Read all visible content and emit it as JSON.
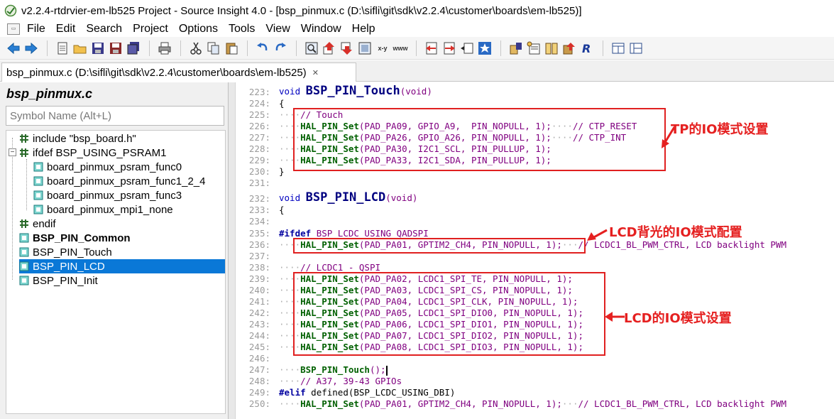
{
  "window": {
    "title": "v2.2.4-rtdrvier-em-lb525 Project - Source Insight 4.0 - [bsp_pinmux.c (D:\\sifli\\git\\sdk\\v2.2.4\\customer\\boards\\em-lb525)]"
  },
  "menu": [
    "File",
    "Edit",
    "Search",
    "Project",
    "Options",
    "Tools",
    "View",
    "Window",
    "Help"
  ],
  "toolbar": {
    "icons": [
      "back-icon",
      "forward-icon",
      "new-file-icon",
      "open-folder-icon",
      "save-icon",
      "save-as-icon",
      "save-all-icon",
      "print-icon",
      "cut-icon",
      "copy-icon",
      "paste-icon",
      "undo-icon",
      "redo-icon",
      "search-icon",
      "jump-up-icon",
      "jump-down-icon",
      "browse-icon",
      "replace-text-icon",
      "web-icon",
      "bookmark-prev-icon",
      "bookmark-next-icon",
      "symbol-window-icon",
      "star-icon",
      "relation-icon",
      "context-icon",
      "book-icon",
      "reference-icon",
      "r-icon",
      "layout-icon",
      "panel-icon"
    ],
    "replace_label": "x-y",
    "web_label": "www"
  },
  "tab": {
    "label": "bsp_pinmux.c (D:\\sifli\\git\\sdk\\v2.2.4\\customer\\boards\\em-lb525)",
    "close": "✕"
  },
  "symbol_panel": {
    "title": "bsp_pinmux.c",
    "search_placeholder": "Symbol Name (Alt+L)",
    "items": [
      {
        "label": "include \"bsp_board.h\"",
        "icon": "include-icon",
        "bold": false,
        "selected": false
      },
      {
        "label": "ifdef BSP_USING_PSRAM1",
        "icon": "ifdef-icon",
        "bold": false,
        "selected": false
      },
      {
        "label": "board_pinmux_psram_func0",
        "icon": "function-icon",
        "bold": false,
        "selected": false
      },
      {
        "label": "board_pinmux_psram_func1_2_4",
        "icon": "function-icon",
        "bold": false,
        "selected": false
      },
      {
        "label": "board_pinmux_psram_func3",
        "icon": "function-icon",
        "bold": false,
        "selected": false
      },
      {
        "label": "board_pinmux_mpi1_none",
        "icon": "function-icon",
        "bold": false,
        "selected": false
      },
      {
        "label": "endif",
        "icon": "endif-icon",
        "bold": false,
        "selected": false
      },
      {
        "label": "BSP_PIN_Common",
        "icon": "function-icon",
        "bold": true,
        "selected": false
      },
      {
        "label": "BSP_PIN_Touch",
        "icon": "function-icon",
        "bold": false,
        "selected": false
      },
      {
        "label": "BSP_PIN_LCD",
        "icon": "function-icon",
        "bold": false,
        "selected": true
      },
      {
        "label": "BSP_PIN_Init",
        "icon": "function-icon",
        "bold": false,
        "selected": false
      }
    ]
  },
  "code": {
    "line_numbers": [
      "223:",
      "224:",
      "225:",
      "226:",
      "227:",
      "228:",
      "229:",
      "230:",
      "231:",
      "232:",
      "233:",
      "234:",
      "235:",
      "236:",
      "237:",
      "238:",
      "239:",
      "240:",
      "241:",
      "242:",
      "243:",
      "244:",
      "245:",
      "246:",
      "247:",
      "248:",
      "249:",
      "250:"
    ],
    "l223_kw": "void",
    "l223_fn": "BSP_PIN_Touch",
    "l223_rest": "(void)",
    "l224": "{",
    "l225_cm": "// Touch",
    "l226_call": "HAL_PIN_Set",
    "l226_args": "(PAD_PA09, GPIO_A9,  PIN_NOPULL, 1);",
    "l226_cm": "// CTP_RESET",
    "l227_call": "HAL_PIN_Set",
    "l227_args": "(PAD_PA26, GPIO_A26, PIN_NOPULL, 1);",
    "l227_cm": "// CTP_INT",
    "l228_call": "HAL_PIN_Set",
    "l228_args": "(PAD_PA30, I2C1_SCL, PIN_PULLUP, 1);",
    "l229_call": "HAL_PIN_Set",
    "l229_args": "(PAD_PA33, I2C1_SDA, PIN_PULLUP, 1);",
    "l230": "}",
    "l232_kw": "void",
    "l232_fn": "BSP_PIN_LCD",
    "l232_rest": "(void)",
    "l233": "{",
    "l235_pp": "#ifdef",
    "l235_rest": "BSP_LCDC_USING_QADSPI",
    "l236_call": "HAL_PIN_Set",
    "l236_args": "(PAD_PA01, GPTIM2_CH4, PIN_NOPULL, 1);",
    "l236_cm": "// LCDC1_BL_PWM_CTRL, LCD backlight PWM",
    "l238_cm": "// LCDC1 - QSPI",
    "l239_call": "HAL_PIN_Set",
    "l239_args": "(PAD_PA02, LCDC1_SPI_TE, PIN_NOPULL, 1);",
    "l240_call": "HAL_PIN_Set",
    "l240_args": "(PAD_PA03, LCDC1_SPI_CS, PIN_NOPULL, 1);",
    "l241_call": "HAL_PIN_Set",
    "l241_args": "(PAD_PA04, LCDC1_SPI_CLK, PIN_NOPULL, 1);",
    "l242_call": "HAL_PIN_Set",
    "l242_args": "(PAD_PA05, LCDC1_SPI_DIO0, PIN_NOPULL, 1);",
    "l243_call": "HAL_PIN_Set",
    "l243_args": "(PAD_PA06, LCDC1_SPI_DIO1, PIN_NOPULL, 1);",
    "l244_call": "HAL_PIN_Set",
    "l244_args": "(PAD_PA07, LCDC1_SPI_DIO2, PIN_NOPULL, 1);",
    "l245_call": "HAL_PIN_Set",
    "l245_args": "(PAD_PA08, LCDC1_SPI_DIO3, PIN_NOPULL, 1);",
    "l247_call": "BSP_PIN_Touch",
    "l247_rest": "();",
    "l248_cm": "// A37, 39-43 GPIOs",
    "l249_pp": "#elif",
    "l249_rest": "defined(BSP_LCDC_USING_DBI)",
    "l250_call": "HAL_PIN_Set",
    "l250_args": "(PAD_PA01, GPTIM2_CH4, PIN_NOPULL, 1);",
    "l250_cm": "// LCDC1_BL_PWM_CTRL, LCD backlight PWM"
  },
  "annotations": {
    "tp": "TP的IO模式设置",
    "backlight": "LCD背光的IO模式配置",
    "lcd": "LCD的IO模式设置",
    "color": "#e52020"
  }
}
